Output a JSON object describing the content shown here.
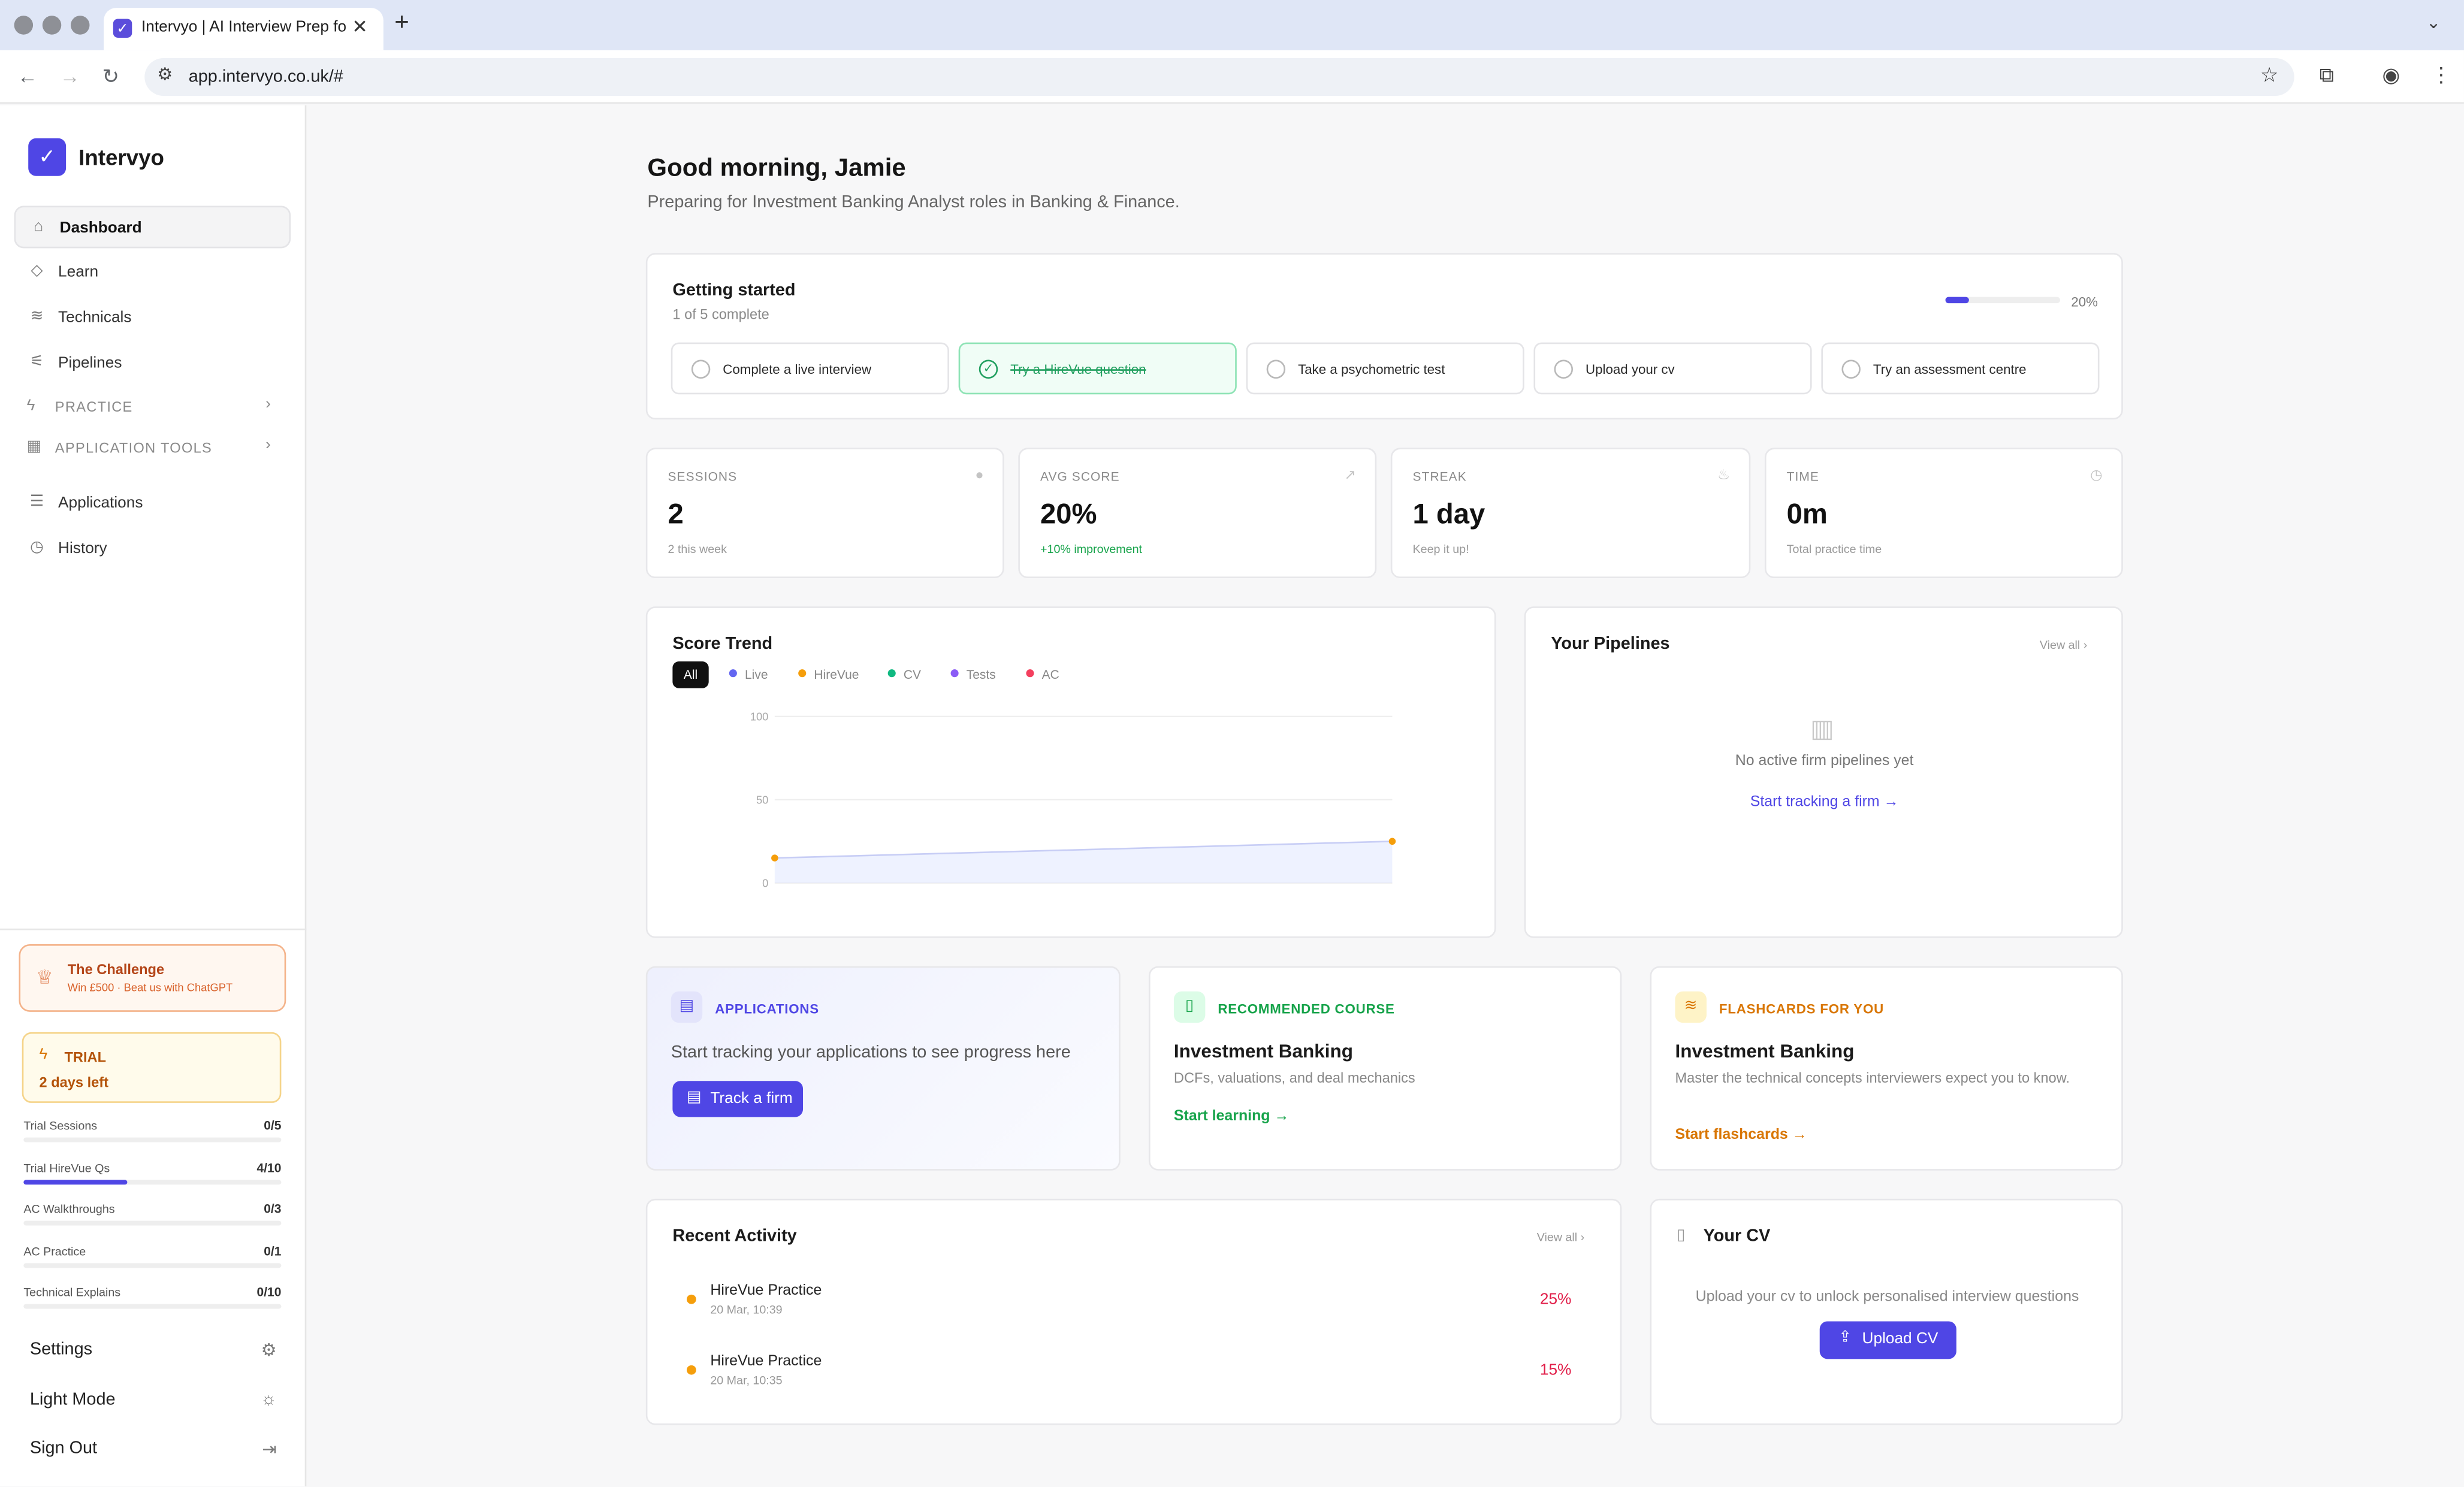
{
  "browser": {
    "tab_title": "Intervyo | AI Interview Prep fo",
    "url": "app.intervyo.co.uk/#"
  },
  "sidebar": {
    "brand": "Intervyo",
    "nav": [
      {
        "label": "Dashboard",
        "icon": "home-icon"
      },
      {
        "label": "Learn",
        "icon": "graduation-cap-icon"
      },
      {
        "label": "Technicals",
        "icon": "layers-icon"
      },
      {
        "label": "Pipelines",
        "icon": "pipeline-icon"
      }
    ],
    "sections": [
      {
        "label": "PRACTICE",
        "icon": "lightning-icon"
      },
      {
        "label": "APPLICATION TOOLS",
        "icon": "briefcase-icon"
      }
    ],
    "nav2": [
      {
        "label": "Applications",
        "icon": "list-icon"
      },
      {
        "label": "History",
        "icon": "clock-icon"
      }
    ],
    "challenge": {
      "title": "The Challenge",
      "subtitle": "Win £500 · Beat us with ChatGPT"
    },
    "trial": {
      "title": "TRIAL",
      "days": "2 days left"
    },
    "usage": [
      {
        "name": "Trial Sessions",
        "count": "0/5",
        "fraction": 0
      },
      {
        "name": "Trial HireVue Qs",
        "count": "4/10",
        "fraction": 0.4
      },
      {
        "name": "AC Walkthroughs",
        "count": "0/3",
        "fraction": 0
      },
      {
        "name": "AC Practice",
        "count": "0/1",
        "fraction": 0
      },
      {
        "name": "Technical Explains",
        "count": "0/10",
        "fraction": 0
      }
    ],
    "footer": [
      {
        "label": "Settings",
        "icon": "gear-icon"
      },
      {
        "label": "Light Mode",
        "icon": "sun-icon"
      },
      {
        "label": "Sign Out",
        "icon": "sign-out-icon"
      }
    ]
  },
  "main": {
    "greeting": "Good morning, Jamie",
    "subtitle": "Preparing for Investment Banking Analyst roles in Banking & Finance.",
    "getting_started": {
      "title": "Getting started",
      "progress_text": "1 of 5 complete",
      "progress_pct": "20%",
      "progress_fraction": 0.2,
      "steps": [
        {
          "label": "Complete a live interview",
          "done": false
        },
        {
          "label": "Try a HireVue question",
          "done": true
        },
        {
          "label": "Take a psychometric test",
          "done": false
        },
        {
          "label": "Upload your cv",
          "done": false
        },
        {
          "label": "Try an assessment centre",
          "done": false
        }
      ]
    },
    "stats": [
      {
        "label": "SESSIONS",
        "value": "2",
        "note": "2 this week",
        "icon": "circle-icon"
      },
      {
        "label": "AVG SCORE",
        "value": "20%",
        "note": "+10% improvement",
        "icon": "trending-up-icon"
      },
      {
        "label": "STREAK",
        "value": "1 day",
        "note": "Keep it up!",
        "icon": "flame-icon"
      },
      {
        "label": "TIME",
        "value": "0m",
        "note": "Total practice time",
        "icon": "clock-icon"
      }
    ],
    "score_trend": {
      "title": "Score Trend",
      "filters": [
        {
          "label": "All",
          "color": "#111111"
        },
        {
          "label": "Live",
          "color": "#6366f1"
        },
        {
          "label": "HireVue",
          "color": "#f59e0b"
        },
        {
          "label": "CV",
          "color": "#10b981"
        },
        {
          "label": "Tests",
          "color": "#8b5cf6"
        },
        {
          "label": "AC",
          "color": "#f43f5e"
        }
      ]
    },
    "pipelines": {
      "title": "Your Pipelines",
      "view_all": "View all",
      "empty": "No active firm pipelines yet",
      "link": "Start tracking a firm →"
    },
    "applications_card": {
      "tag": "APPLICATIONS",
      "text": "Start tracking your applications to see progress here",
      "button": "Track a firm"
    },
    "course_card": {
      "tag": "RECOMMENDED COURSE",
      "title": "Investment Banking",
      "desc": "DCFs, valuations, and deal mechanics",
      "link": "Start learning"
    },
    "flashcards_card": {
      "tag": "FLASHCARDS FOR YOU",
      "title": "Investment Banking",
      "desc": "Master the technical concepts interviewers expect you to know.",
      "link": "Start flashcards"
    },
    "recent_activity": {
      "title": "Recent Activity",
      "view_all": "View all",
      "items": [
        {
          "name": "HireVue Practice",
          "date": "20 Mar, 10:39",
          "score": "25%"
        },
        {
          "name": "HireVue Practice",
          "date": "20 Mar, 10:35",
          "score": "15%"
        }
      ]
    },
    "cv": {
      "title": "Your CV",
      "desc": "Upload your cv to unlock personalised interview questions",
      "button": "Upload CV"
    }
  },
  "chart_data": {
    "type": "line",
    "title": "Score Trend",
    "ylim": [
      0,
      100
    ],
    "yticks": [
      0,
      50,
      100
    ],
    "grid": true,
    "series": [
      {
        "name": "HireVue",
        "color": "#f59e0b",
        "values": [
          15,
          25
        ]
      }
    ]
  }
}
